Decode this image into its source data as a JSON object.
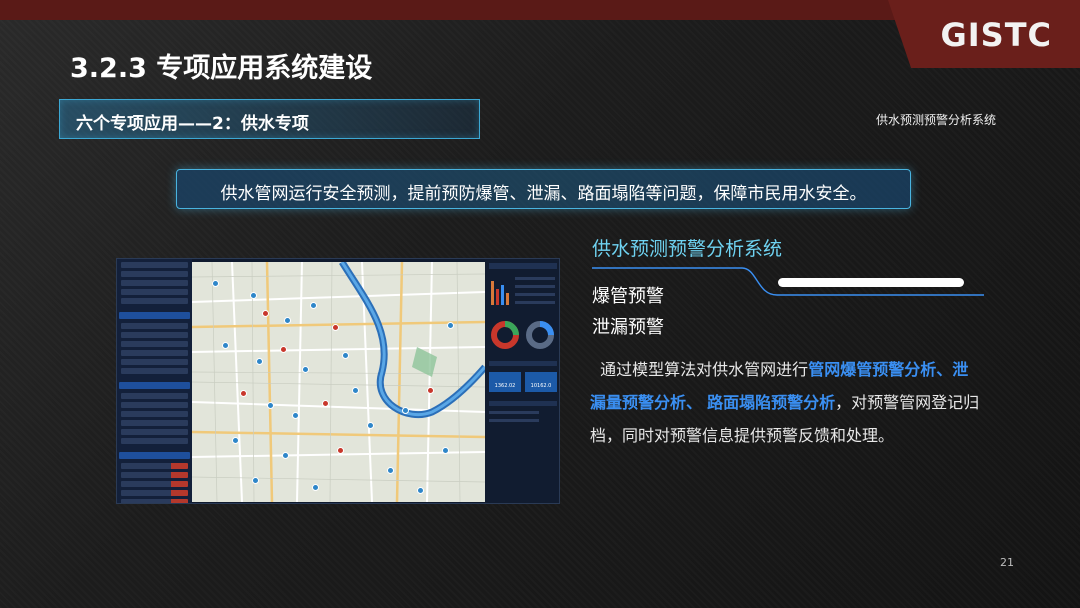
{
  "header": {
    "logo": "GISTC",
    "page_title": "3.2.3 专项应用系统建设",
    "section_label": "六个专项应用——2：供水专项",
    "top_right_label": "供水预测预警分析系统"
  },
  "banner": {
    "text": "供水管网运行安全预测，提前预防爆管、泄漏、路面塌陷等问题，保障市民用水安全。"
  },
  "right": {
    "title": "供水预测预警分析系统",
    "items": [
      "爆管预警",
      "泄漏预警"
    ],
    "desc_prefix": "通过模型算法对供水管网进行",
    "hl1": "管网爆管预警分析、",
    "hl2": "泄漏量预警分析、",
    "hl3": "路面塌陷预警分析",
    "desc_suffix": "，对预警管网登记归档，同时对预警信息提供预警反馈和处理。"
  },
  "screenshot_panel": {
    "stat1": "1362.02",
    "stat2": "10162.0"
  },
  "page_number": "21",
  "colors": {
    "accent_blue": "#3a8ff2",
    "title_cyan": "#6fd3f2",
    "brand_red": "#6a1f1b"
  }
}
